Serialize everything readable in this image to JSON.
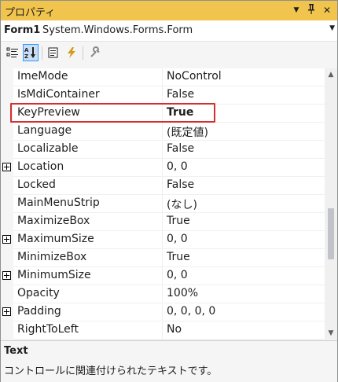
{
  "window": {
    "title": "プロパティ",
    "dropdown_icon": "▼",
    "pin_icon": "ᛘ",
    "close_icon": "✕"
  },
  "object_selector": {
    "name": "Form1",
    "type": "System.Windows.Forms.Form"
  },
  "toolbar": {
    "buttons": [
      {
        "icon": "categorized-icon",
        "active": false
      },
      {
        "icon": "alphabetical-icon",
        "active": true
      },
      {
        "icon": "properties-icon",
        "active": false
      },
      {
        "icon": "events-icon",
        "active": false
      },
      {
        "icon": "property-pages-icon",
        "active": false
      }
    ]
  },
  "properties": [
    {
      "name": "ImeMode",
      "value": "NoControl",
      "expandable": false,
      "bold": false
    },
    {
      "name": "IsMdiContainer",
      "value": "False",
      "expandable": false,
      "bold": false
    },
    {
      "name": "KeyPreview",
      "value": "True",
      "expandable": false,
      "bold": true
    },
    {
      "name": "Language",
      "value": "(既定値)",
      "expandable": false,
      "bold": false
    },
    {
      "name": "Localizable",
      "value": "False",
      "expandable": false,
      "bold": false
    },
    {
      "name": "Location",
      "value": "0, 0",
      "expandable": true,
      "bold": false
    },
    {
      "name": "Locked",
      "value": "False",
      "expandable": false,
      "bold": false
    },
    {
      "name": "MainMenuStrip",
      "value": "(なし)",
      "expandable": false,
      "bold": false
    },
    {
      "name": "MaximizeBox",
      "value": "True",
      "expandable": false,
      "bold": false
    },
    {
      "name": "MaximumSize",
      "value": "0, 0",
      "expandable": true,
      "bold": false
    },
    {
      "name": "MinimizeBox",
      "value": "True",
      "expandable": false,
      "bold": false
    },
    {
      "name": "MinimumSize",
      "value": "0, 0",
      "expandable": true,
      "bold": false
    },
    {
      "name": "Opacity",
      "value": "100%",
      "expandable": false,
      "bold": false
    },
    {
      "name": "Padding",
      "value": "0, 0, 0, 0",
      "expandable": true,
      "bold": false
    },
    {
      "name": "RightToLeft",
      "value": "No",
      "expandable": false,
      "bold": false
    }
  ],
  "description": {
    "title": "Text",
    "text": "コントロールに関連付けられたテキストです。"
  },
  "colors": {
    "titlebar": "#f0c44d",
    "highlight_border": "#d32f2f",
    "active_button": "#c9def5"
  }
}
